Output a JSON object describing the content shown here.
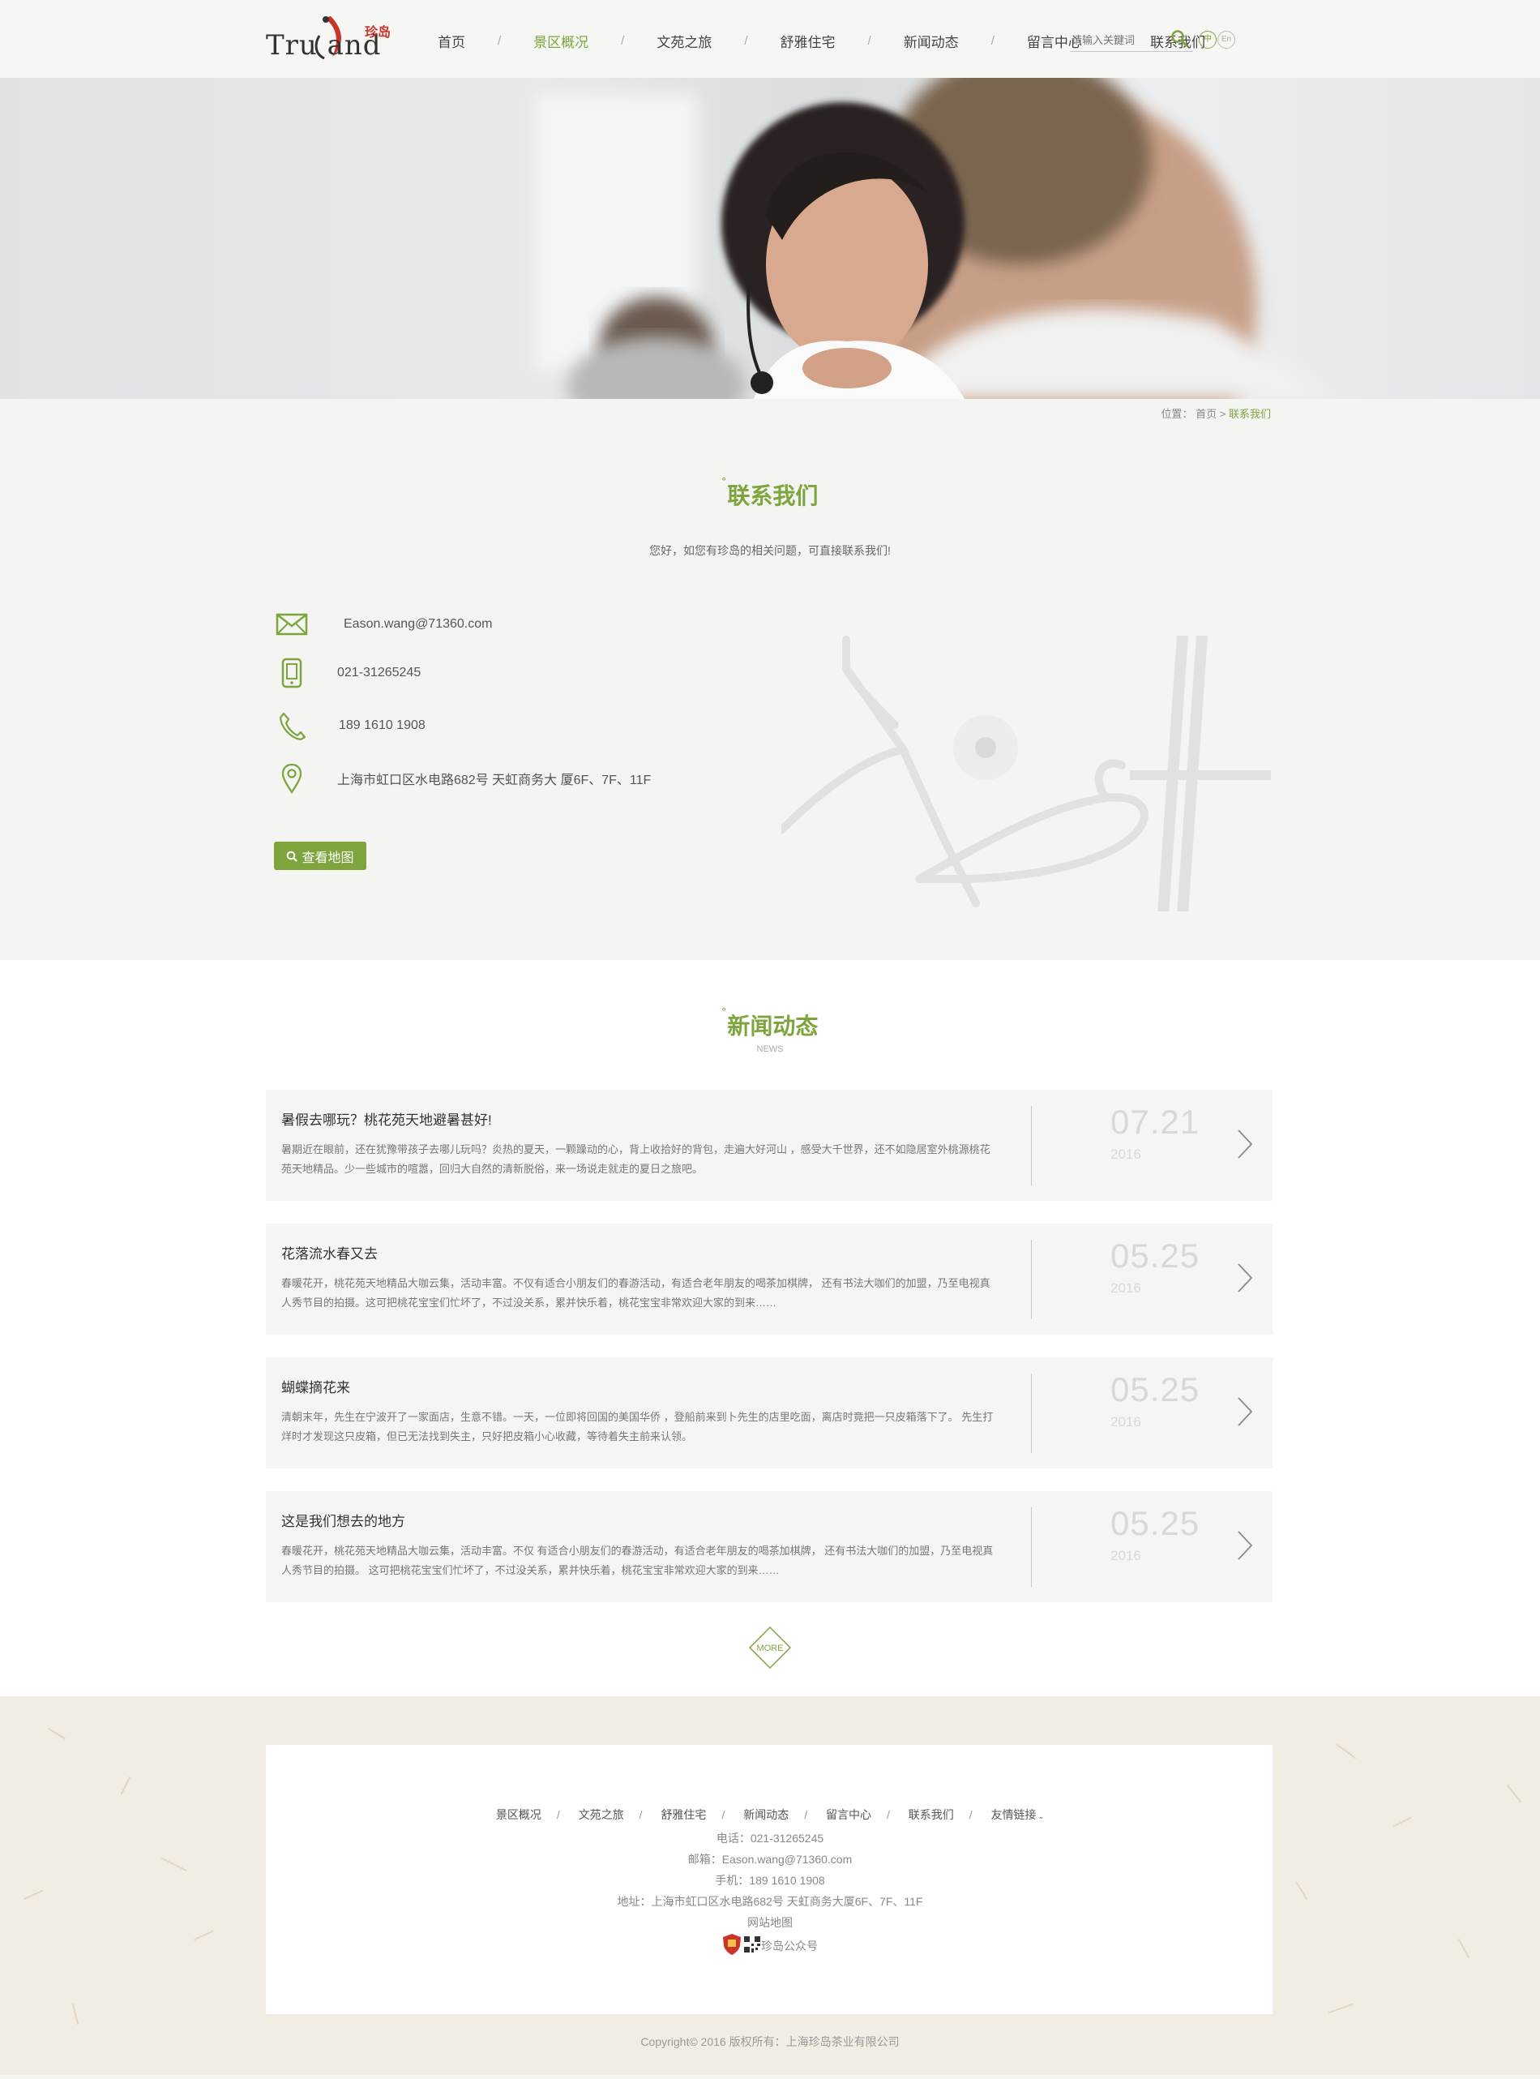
{
  "header": {
    "logo_text": "Tru and",
    "logo_cn": "珍岛",
    "nav": [
      {
        "label": "首页"
      },
      {
        "label": "景区概况",
        "active": true
      },
      {
        "label": "文苑之旅"
      },
      {
        "label": "舒雅住宅"
      },
      {
        "label": "新闻动态"
      },
      {
        "label": "留言中心"
      },
      {
        "label": "联系我们"
      }
    ],
    "nav_separator": "/",
    "search_placeholder": "请输入关键词",
    "lang_zh": "中",
    "lang_en": "En"
  },
  "breadcrumb": {
    "prefix": "位置：",
    "home": "首页",
    "sep": ">",
    "current": "联系我们"
  },
  "contact": {
    "title_dot": "°",
    "title": "联系我们",
    "intro": "您好，如您有珍岛的相关问题，可直接联系我们!",
    "email": "Eason.wang@71360.com",
    "tel": "021-31265245",
    "mobile": "189 1610 1908",
    "address": "上海市虹口区水电路682号 天虹商务大 厦6F、7F、11F",
    "map_button": "查看地图"
  },
  "news": {
    "title_dot": "°",
    "title": "新闻动态",
    "subtitle": "NEWS",
    "items": [
      {
        "title": "暑假去哪玩？桃花苑天地避暑甚好!",
        "desc": "暑期近在眼前，还在犹豫带孩子去哪儿玩吗？炎热的夏天，一颗躁动的心，背上收拾好的背包，走遍大好河山 ，感受大千世界，还不如隐居室外桃源桃花苑天地精品。少一些城市的喧嚣，回归大自然的清新脱俗，来一场说走就走的夏日之旅吧。",
        "date": "07.21",
        "year": "2016"
      },
      {
        "title": "花落流水春又去",
        "desc": "春暖花开，桃花苑天地精品大咖云集，活动丰富。不仅有适合小朋友们的春游活动，有适合老年朋友的喝茶加棋牌， 还有书法大咖们的加盟，乃至电视真人秀节目的拍摄。这可把桃花宝宝们忙坏了，不过没关系，累并快乐着，桃花宝宝非常欢迎大家的到来……",
        "date": "05.25",
        "year": "2016"
      },
      {
        "title": "蝴蝶摘花来",
        "desc": "清朝末年，先生在宁波开了一家面店，生意不错。一天，一位即将回国的美国华侨 ，登船前来到卜先生的店里吃面，离店时竟把一只皮箱落下了。 先生打烊时才发现这只皮箱，但已无法找到失主，只好把皮箱小心收藏，等待着失主前来认领。",
        "date": "05.25",
        "year": "2016"
      },
      {
        "title": "这是我们想去的地方",
        "desc": "春暖花开，桃花苑天地精品大咖云集，活动丰富。不仅 有适合小朋友们的春游活动，有适合老年朋友的喝茶加棋牌， 还有书法大咖们的加盟，乃至电视真人秀节目的拍摄。 这可把桃花宝宝们忙坏了，不过没关系，累并快乐着，桃花宝宝非常欢迎大家的到来……",
        "date": "05.25",
        "year": "2016"
      }
    ],
    "more": "MORE"
  },
  "footer": {
    "nav": [
      "景区概况",
      "文苑之旅",
      "舒雅住宅",
      "新闻动态",
      "留言中心",
      "联系我们"
    ],
    "nav_separator": "/",
    "friend_links": "友情链接",
    "phone": "电话：021-31265245",
    "email": "邮箱：Eason.wang@71360.com",
    "mobile": "手机：189 1610 1908",
    "address": "地址：上海市虹口区水电路682号 天虹商务大厦6F、7F、11F",
    "sitemap": "网站地图",
    "wechat": "珍岛公众号",
    "copyright": "Copyright© 2016 版权所有：上海珍岛茶业有限公司"
  },
  "colors": {
    "accent": "#7ea53d",
    "text": "#555555",
    "footer_bg": "#f2ede2"
  }
}
